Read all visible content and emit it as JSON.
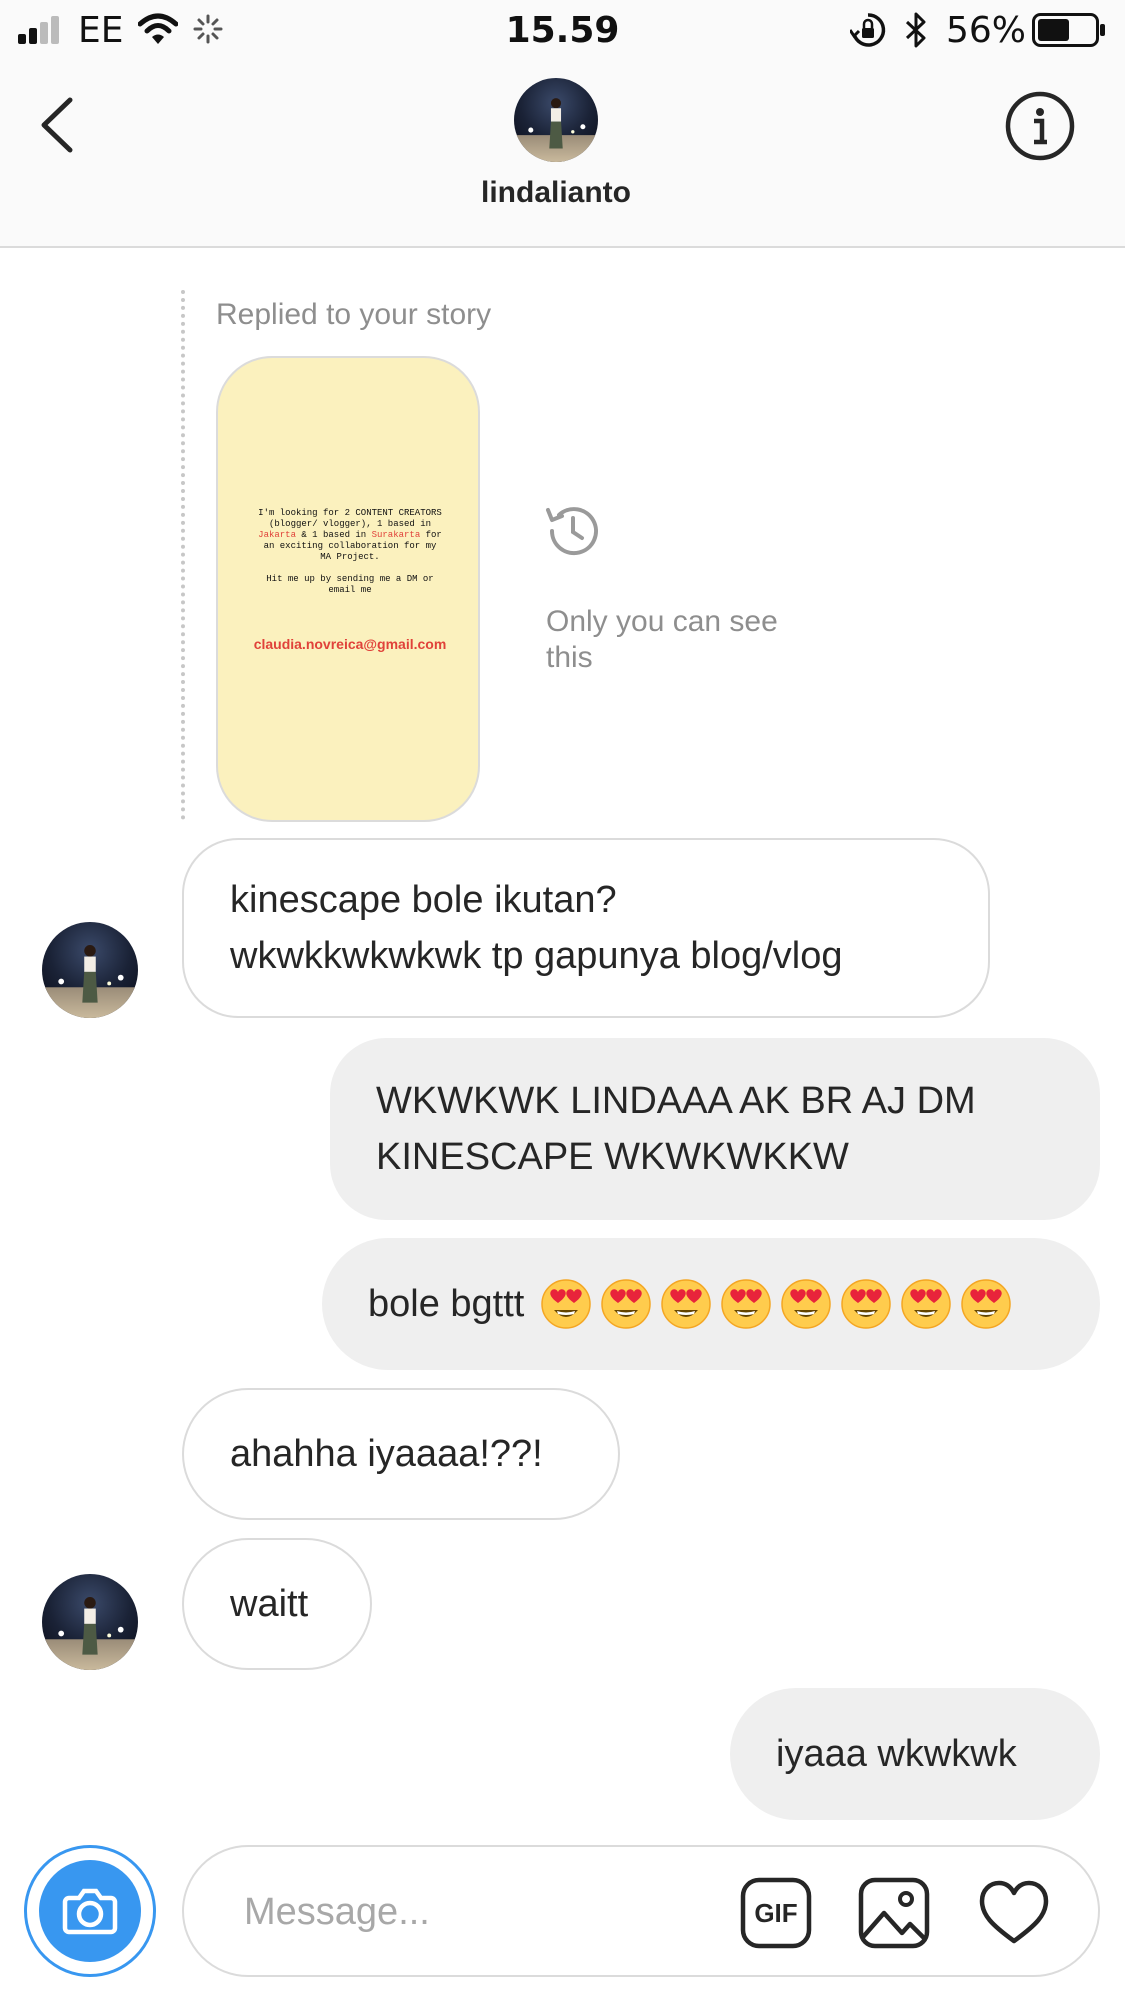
{
  "status_bar": {
    "carrier": "EE",
    "time": "15.59",
    "battery_percent": "56%",
    "battery_level": 0.56
  },
  "header": {
    "username": "lindalianto",
    "back_icon": "chevron-left-icon",
    "info_icon": "info-circle-icon"
  },
  "story_reply": {
    "label": "Replied to your story",
    "story_lines": {
      "part1": "I'm looking for 2 CONTENT CREATORS (blogger/ vlogger), 1 based in ",
      "city1": "Jakarta",
      "part2": " & 1 based in ",
      "city2": "Surakarta",
      "part3": " for an exciting collaboration for my MA Project.",
      "part4": "Hit me up by sending me a DM or email me"
    },
    "email": "claudia.novreica@gmail.com",
    "privacy_note": "Only you can see this"
  },
  "messages": [
    {
      "id": "m1",
      "direction": "incoming",
      "text": "kinescape bole ikutan?\nwkwkkwkwkwk tp gapunya blog/vlog"
    },
    {
      "id": "m2",
      "direction": "outgoing",
      "text": "WKWKWK LINDAAA AK BR AJ DM\nKINESCAPE WKWKWKKW"
    },
    {
      "id": "m3",
      "direction": "outgoing",
      "text": "bole bgttt",
      "emoji_count": 8,
      "emoji": "heart-eyes-emoji"
    },
    {
      "id": "m4",
      "direction": "incoming",
      "text": "ahahha iyaaaa!??!"
    },
    {
      "id": "m5",
      "direction": "incoming",
      "text": "waitt"
    },
    {
      "id": "m6",
      "direction": "outgoing",
      "text": "iyaaa wkwkwk"
    }
  ],
  "composer": {
    "placeholder": "Message...",
    "gif_label": "GIF",
    "camera_icon": "camera-icon",
    "gallery_icon": "gallery-icon",
    "like_icon": "heart-icon"
  },
  "colors": {
    "accent": "#3897f0",
    "incoming_bubble": "#ffffff",
    "outgoing_bubble": "#efefef",
    "story_background": "#fbf1be",
    "story_highlight": "#e0423a",
    "muted_text": "#8e8e8e"
  }
}
